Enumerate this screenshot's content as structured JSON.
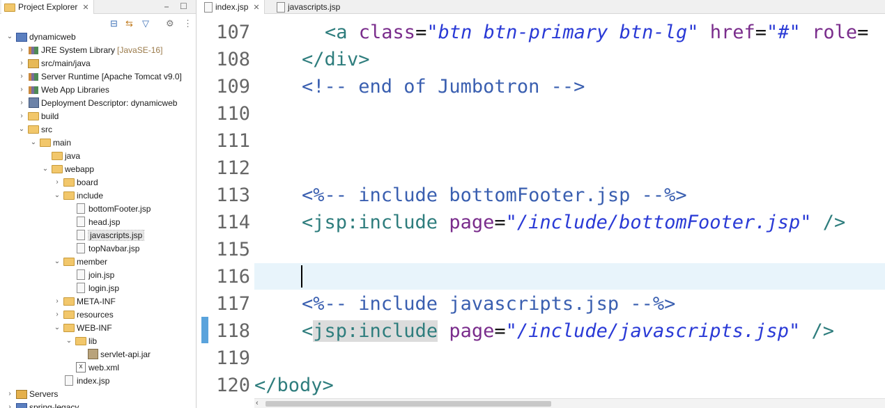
{
  "explorer": {
    "title": "Project Explorer",
    "tab_close": "✕",
    "minimize": "⎯",
    "maximize": "☐",
    "toolbar_icons": [
      "collapse-all-icon",
      "link-with-editor-icon",
      "filter-icon",
      "sync-icon",
      "view-menu-icon"
    ],
    "tree": [
      {
        "label": "dynamicweb",
        "decor": "",
        "depth": 0,
        "twisty": "⌄",
        "icon": "project"
      },
      {
        "label": "JRE System Library",
        "decor": "[JavaSE-16]",
        "depth": 1,
        "twisty": "›",
        "icon": "lib"
      },
      {
        "label": "src/main/java",
        "decor": "",
        "depth": 1,
        "twisty": "›",
        "icon": "pkg"
      },
      {
        "label": "Server Runtime [Apache Tomcat v9.0]",
        "decor": "",
        "depth": 1,
        "twisty": "›",
        "icon": "lib"
      },
      {
        "label": "Web App Libraries",
        "decor": "",
        "depth": 1,
        "twisty": "›",
        "icon": "lib"
      },
      {
        "label": "Deployment Descriptor: dynamicweb",
        "decor": "",
        "depth": 1,
        "twisty": "›",
        "icon": "desc"
      },
      {
        "label": "build",
        "decor": "",
        "depth": 1,
        "twisty": "›",
        "icon": "folder"
      },
      {
        "label": "src",
        "decor": "",
        "depth": 1,
        "twisty": "⌄",
        "icon": "folder"
      },
      {
        "label": "main",
        "decor": "",
        "depth": 2,
        "twisty": "⌄",
        "icon": "folder"
      },
      {
        "label": "java",
        "decor": "",
        "depth": 3,
        "twisty": "",
        "icon": "folder"
      },
      {
        "label": "webapp",
        "decor": "",
        "depth": 3,
        "twisty": "⌄",
        "icon": "folder"
      },
      {
        "label": "board",
        "decor": "",
        "depth": 4,
        "twisty": "›",
        "icon": "folder"
      },
      {
        "label": "include",
        "decor": "",
        "depth": 4,
        "twisty": "⌄",
        "icon": "folder"
      },
      {
        "label": "bottomFooter.jsp",
        "decor": "",
        "depth": 5,
        "twisty": "",
        "icon": "file"
      },
      {
        "label": "head.jsp",
        "decor": "",
        "depth": 5,
        "twisty": "",
        "icon": "file"
      },
      {
        "label": "javascripts.jsp",
        "decor": "",
        "depth": 5,
        "twisty": "",
        "icon": "file",
        "selected": true
      },
      {
        "label": "topNavbar.jsp",
        "decor": "",
        "depth": 5,
        "twisty": "",
        "icon": "file"
      },
      {
        "label": "member",
        "decor": "",
        "depth": 4,
        "twisty": "⌄",
        "icon": "folder"
      },
      {
        "label": "join.jsp",
        "decor": "",
        "depth": 5,
        "twisty": "",
        "icon": "file"
      },
      {
        "label": "login.jsp",
        "decor": "",
        "depth": 5,
        "twisty": "",
        "icon": "file"
      },
      {
        "label": "META-INF",
        "decor": "",
        "depth": 4,
        "twisty": "›",
        "icon": "folder"
      },
      {
        "label": "resources",
        "decor": "",
        "depth": 4,
        "twisty": "›",
        "icon": "folder"
      },
      {
        "label": "WEB-INF",
        "decor": "",
        "depth": 4,
        "twisty": "⌄",
        "icon": "folder"
      },
      {
        "label": "lib",
        "decor": "",
        "depth": 5,
        "twisty": "⌄",
        "icon": "folder"
      },
      {
        "label": "servlet-api.jar",
        "decor": "",
        "depth": 6,
        "twisty": "",
        "icon": "jar"
      },
      {
        "label": "web.xml",
        "decor": "",
        "depth": 5,
        "twisty": "",
        "icon": "xml"
      },
      {
        "label": "index.jsp",
        "decor": "",
        "depth": 4,
        "twisty": "",
        "icon": "file"
      },
      {
        "label": "Servers",
        "decor": "",
        "depth": 0,
        "twisty": "›",
        "icon": "server"
      },
      {
        "label": "spring-legacy",
        "decor": "",
        "depth": 0,
        "twisty": "›",
        "icon": "project"
      }
    ]
  },
  "editor": {
    "tabs": [
      {
        "label": "index.jsp",
        "active": true,
        "close": "✕"
      },
      {
        "label": "javascripts.jsp",
        "active": false
      }
    ],
    "line_numbers": [
      "107",
      "108",
      "109",
      "110",
      "111",
      "112",
      "113",
      "114",
      "115",
      "116",
      "117",
      "118",
      "119",
      "120"
    ],
    "lines": {
      "l107": {
        "open": "<a ",
        "a1": "class",
        "eq1": "=",
        "s1": "\"btn btn-primary btn-lg\"",
        "sp": " ",
        "a2": "href",
        "eq2": "=",
        "s2": "\"#\"",
        "sp2": " ",
        "a3": "role",
        "eq3": "="
      },
      "l108": {
        "text": "</div>"
      },
      "l109": {
        "text": "<!-- end of Jumbotron -->"
      },
      "l113": {
        "text": "<%-- include bottomFooter.jsp --%>"
      },
      "l114": {
        "open": "<jsp:include ",
        "attr": "page",
        "eq": "=",
        "str": "\"/include/bottomFooter.jsp\"",
        "close": " />"
      },
      "l117": {
        "text": "<%-- include javascripts.jsp --%>"
      },
      "l118": {
        "lt": "<",
        "name": "jsp:include",
        "sp": " ",
        "attr": "page",
        "eq": "=",
        "str": "\"/include/javascripts.jsp\"",
        "close": " />"
      },
      "l120": {
        "text": "</body>"
      }
    },
    "scroll_left": "‹",
    "ibeam": "I"
  }
}
